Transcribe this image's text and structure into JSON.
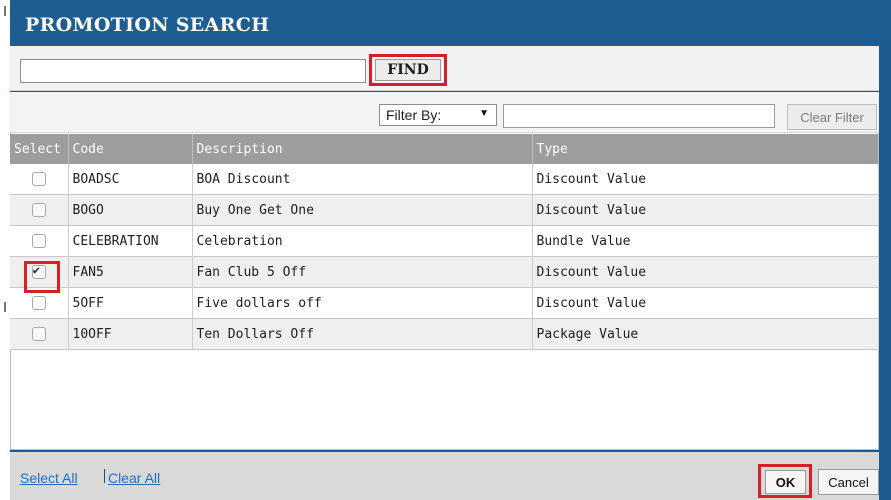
{
  "dialog": {
    "title": "PROMOTION SEARCH"
  },
  "search": {
    "value": "",
    "find_label": "FIND"
  },
  "filter": {
    "select_label": "Filter By:",
    "value": "",
    "clear_label": "Clear Filter"
  },
  "table": {
    "headers": [
      "Select",
      "Code",
      "Description",
      "Type"
    ],
    "rows": [
      {
        "checked": false,
        "code": "BOADSC",
        "description": "BOA Discount",
        "type": "Discount Value"
      },
      {
        "checked": false,
        "code": "BOGO",
        "description": "Buy One Get One",
        "type": "Discount Value"
      },
      {
        "checked": false,
        "code": "CELEBRATION",
        "description": "Celebration",
        "type": "Bundle Value"
      },
      {
        "checked": true,
        "code": "FAN5",
        "description": "Fan Club 5 Off",
        "type": "Discount Value"
      },
      {
        "checked": false,
        "code": "5OFF",
        "description": "Five dollars off",
        "type": "Discount Value"
      },
      {
        "checked": false,
        "code": "10OFF",
        "description": "Ten Dollars Off",
        "type": "Package Value"
      }
    ]
  },
  "footer": {
    "select_all": "Select All",
    "clear_all": "Clear All",
    "ok": "OK",
    "cancel": "Cancel"
  },
  "colors": {
    "title_bar": "#1e5d92",
    "highlight": "#d62027",
    "header_row": "#9d9d9d",
    "link": "#1f6fc1"
  }
}
